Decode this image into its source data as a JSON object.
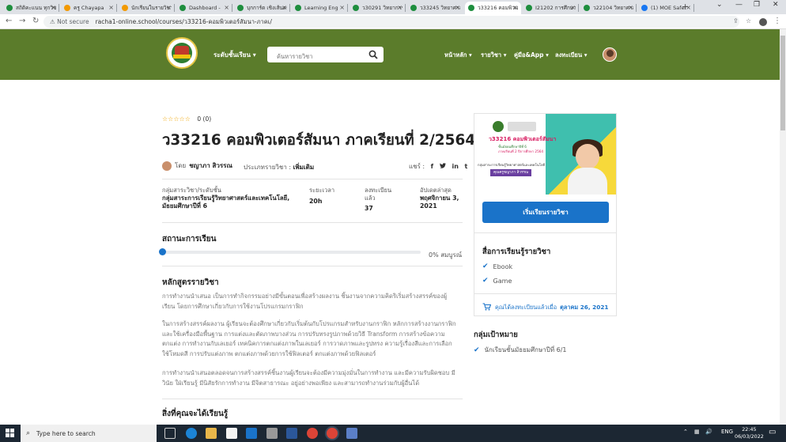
{
  "browser": {
    "tabs": [
      {
        "title": "สถิติคะแนน ทุกวิชา",
        "color": "#1e8e3e"
      },
      {
        "title": "ครู Chayapa",
        "color": "#f29900"
      },
      {
        "title": "นักเรียนในรายวิชา",
        "color": "#f29900"
      },
      {
        "title": "Dashboard -",
        "color": "#1e8e3e"
      },
      {
        "title": "บุกการ์ด เชิงเส้นตรง",
        "color": "#1e8e3e"
      },
      {
        "title": "Learning Eng",
        "color": "#1e8e3e"
      },
      {
        "title": "ว30291 วิทยาการ",
        "color": "#1e8e3e"
      },
      {
        "title": "ว33245 วิทยาศาสตร์",
        "color": "#1e8e3e"
      },
      {
        "title": "ว33216 คอมพิวเตอร์",
        "color": "#1e8e3e"
      },
      {
        "title": "I21202 การศึกษา",
        "color": "#1e8e3e"
      },
      {
        "title": "ว22104 วิทยาศาสตร์",
        "color": "#1e8e3e"
      },
      {
        "title": "(1) MOE Safe",
        "color": "#1877f2"
      }
    ],
    "active_tab": 8,
    "new_tab_icon": "+",
    "window_controls": [
      "⌄",
      "—",
      "❐",
      "✕"
    ],
    "not_secure": "Not secure",
    "url": "racha1-online.school/courses/ว33216-คอมพิวเตอร์สัมนา-ภาคเ/"
  },
  "header": {
    "category_menu": "ระดับชั้นเรียน",
    "search_placeholder": "ค้นหารายวิชา",
    "nav": [
      "หน้าหลัก",
      "รายวิชา",
      "คู่มือ&App",
      "ลงทะเบียน"
    ]
  },
  "course": {
    "stars": "☆☆☆☆☆",
    "rating_count": "0 (0)",
    "title": "ว33216 คอมพิวเตอร์สัมนา ภาคเรียนที่ 2/2564",
    "by_prefix": "โดย",
    "instructor": "ชญาภา สิวรรณ",
    "category_label": "ประเภทรายวิชา :",
    "category_value": "เพิ่มเติม",
    "share_label": "แชร์ :",
    "share_icons": [
      "f",
      "🐦",
      "in",
      "t"
    ],
    "meta": [
      {
        "label": "กลุ่มสาระวิชา/ระดับชั้น",
        "value_lines": [
          "กลุ่มสาระการเรียนรู้วิทยาศาสตร์และเทคโนโลยี,",
          "มัธยมศึกษาปีที่ 6"
        ]
      },
      {
        "label": "ระยะเวลา",
        "value_lines": [
          "20h"
        ]
      },
      {
        "label_lines": [
          "ลงทะเบียน",
          "แล้ว"
        ],
        "value_lines": [
          "37"
        ]
      },
      {
        "label": "อัปเดตล่าสุด",
        "value_lines": [
          "พฤศจิกายน 3,",
          "2021"
        ]
      }
    ],
    "progress_heading": "สถานะการเรียน",
    "progress": 0,
    "progress_label": "0% สมบูรณ์",
    "curriculum_heading": "หลักสูตรรายวิชา",
    "paragraphs": [
      [
        "การทำงานนำเสนอ เป็นการทำกิจกรรมอย่างมีขั้นตอนเพื่อสร้างผลงาน ชิ้นงานจากความคิดริเริ่มสร้างสรรค์ของผู้",
        "เรียน โดยการศึกษาเกี่ยวกับการใช้งานโปรแกรมกราฟิก"
      ],
      [
        "ในการสร้างสรรค์ผลงาน ผู้เรียนจะต้องศึกษาเกี่ยวกับเริ่มต้นกับโปรแกรมสำหรับงานกราฟิก หลักการสร้างงานกราฟิก",
        "และใช้เครื่องมือพื้นฐาน การแต่งและตัดภาพบางส่วน การปรับทรงรูปภาพด้วยวิธี Transform การสร้างข้อความ",
        "ตกแต่ง การทำงานกับเลเยอร์ เทคนิคการตกแต่งภาพในเลเยอร์ การวาดภาพและรูปทรง ความรู้เรื่องสีและการเลือก",
        "ใช้โหมดสี การปรับแต่งภาพ ตกแต่งภาพด้วยการใช้ฟิลเตอร์ ตกแต่งภาพด้วยฟิลเตอร์"
      ],
      [
        "การทำงานนำเสนอตลอดจนการสร้างสรรค์ชิ้นงานผู้เรียนจะต้องมีความมุ่งมั่นในการทำงาน และมีความรับผิดชอบ มี",
        "วินัย ใฝ่เรียนรู้ มีนิสัยรักการทำงาน มีจิตสาธารณะ อยู่อย่างพอเพียง และสามารถทำงานร่วมกับผู้อื่นได้"
      ]
    ],
    "learn_heading": "สิ่งที่คุณจะได้เรียนรู้"
  },
  "sidebar": {
    "thumb_title": "ว33216 คอมพิวเตอร์สัมนา",
    "thumb_line1": "ชั้นมัธยมศึกษาปีที่ 6",
    "thumb_line2": "ภาคเรียนที่ 2 ปีการศึกษา 2564",
    "thumb_line3": "กลุ่มสาระการเรียนรู้วิทยาศาสตร์และเทคโนโลยี",
    "thumb_teacher": "คุณครูชญาภา สิวรรณ",
    "enroll_button": "เริ่มเรียนรายวิชา",
    "materials_heading": "สื่อการเรียนรู้รายวิชา",
    "materials": [
      "Ebook",
      "Game"
    ],
    "last_enroll_label": "คุณได้ลงทะเบียนแล้วเมื่อ",
    "last_enroll_date": "ตุลาคม 26, 2021",
    "target_heading": "กลุ่มเป้าหมาย",
    "target_items": [
      "นักเรียนชั้นมัธยมศึกษาปีที่ 6/1"
    ]
  },
  "taskbar": {
    "search_placeholder": "Type here to search",
    "lang": "ENG",
    "time": "22:45",
    "date": "06/03/2022"
  },
  "colors": {
    "header_green": "#5b7c2b",
    "accent_blue": "#1a73c9"
  }
}
